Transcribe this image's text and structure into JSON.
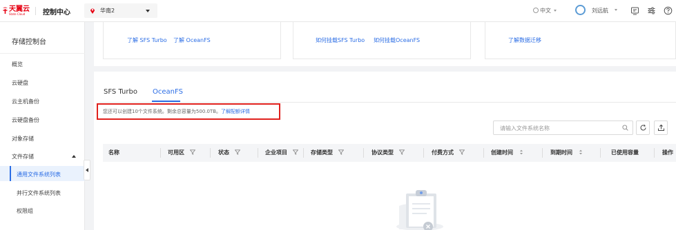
{
  "header": {
    "logo_cn": "天翼云",
    "logo_en": "State Cloud",
    "title": "控制中心",
    "region": "华南2",
    "language": "中文",
    "username": "刘远航",
    "brand_color": "#e60012",
    "icons": [
      "location-pin-icon",
      "globe-icon",
      "user-avatar-icon",
      "notification-icon",
      "settings-sliders-icon",
      "help-icon"
    ]
  },
  "sidebar": {
    "title": "存储控制台",
    "items": [
      {
        "label": "概览"
      },
      {
        "label": "云硬盘"
      },
      {
        "label": "云主机备份"
      },
      {
        "label": "云硬盘备份"
      },
      {
        "label": "对象存储"
      },
      {
        "label": "文件存储"
      }
    ],
    "sub_items": [
      {
        "label": "通用文件系统列表",
        "active": true
      },
      {
        "label": "并行文件系统列表"
      },
      {
        "label": "权限组"
      }
    ],
    "active_color": "#2b6de5"
  },
  "cards": [
    {
      "links": [
        "了解 SFS Turbo",
        "了解 OceanFS"
      ]
    },
    {
      "links": [
        "如何挂载SFS Turbo",
        "如何挂载OceanFS"
      ]
    },
    {
      "links": [
        "了解数据迁移"
      ]
    }
  ],
  "main": {
    "tabs": [
      {
        "label": "SFS Turbo",
        "active": false
      },
      {
        "label": "OceanFS",
        "active": true
      }
    ],
    "notice_text": "您还可以创建10个文件系统。剩余总容量为500.0TB。",
    "notice_link": "了解配额详情",
    "search_placeholder": "请输入文件系统名称",
    "columns": [
      "名称",
      "可用区",
      "状态",
      "企业项目",
      "存储类型",
      "协议类型",
      "付费方式",
      "创建时间",
      "到期时间",
      "已使用容量",
      "操作"
    ],
    "highlight_color": "#e0201c"
  }
}
